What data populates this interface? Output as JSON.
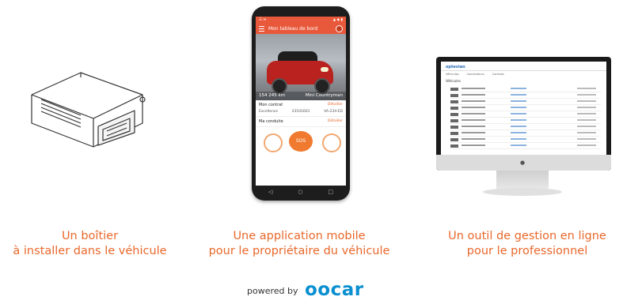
{
  "captions": [
    {
      "line1": "Un boîtier",
      "line2": "à installer dans le véhicule"
    },
    {
      "line1": "Une application mobile",
      "line2": "pour le propriétaire du véhicule"
    },
    {
      "line1": "Un outil de gestion en ligne",
      "line2": "pour le professionnel"
    }
  ],
  "footer": {
    "powered_by": "powered by",
    "brand": "oocar"
  },
  "phone": {
    "app_title": "Mon tableau de bord",
    "mileage": "154 245 km",
    "car_name": "Mini Countryman",
    "contract_section": {
      "title": "Mon contrat",
      "link": "Détailler",
      "values": [
        "Excellence",
        "23541601",
        "VA-234-ED"
      ]
    },
    "driver_section": {
      "title": "Ma conduite",
      "link": "Détailler"
    },
    "sos_label": "SOS",
    "brand_color": "#e8583a"
  },
  "monitor": {
    "logo": "optevian",
    "tabs": [
      "Véhicules",
      "Conducteurs",
      "Contrats"
    ],
    "section_title": "Véhicules"
  }
}
